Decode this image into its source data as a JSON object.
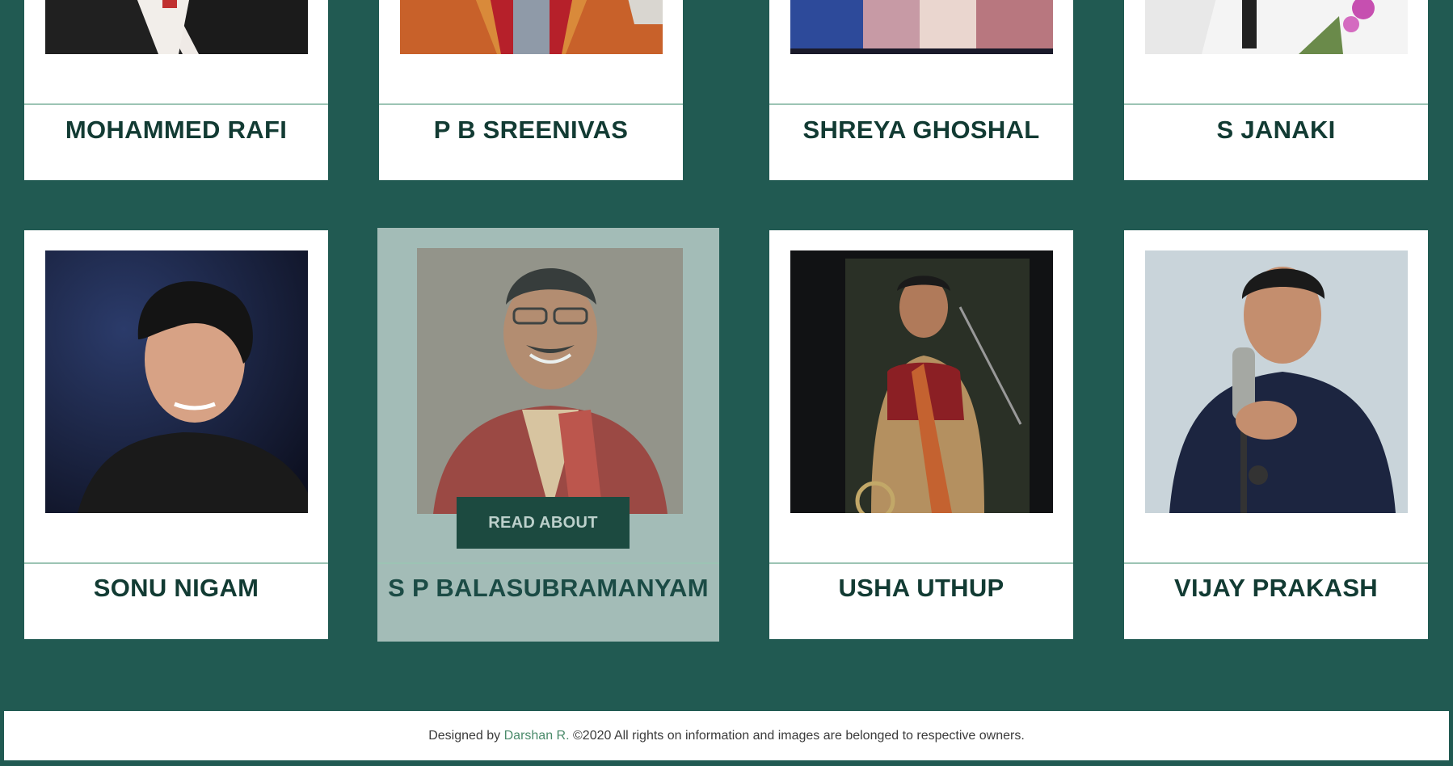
{
  "row1": [
    {
      "name": "MOHAMMED RAFI"
    },
    {
      "name": "P B SREENIVAS"
    },
    {
      "name": "SHREYA GHOSHAL"
    },
    {
      "name": "S JANAKI"
    }
  ],
  "row2": [
    {
      "name": "SONU NIGAM"
    },
    {
      "name": "S P BALASUBRAMANYAM",
      "button": "READ ABOUT"
    },
    {
      "name": "USHA UTHUP"
    },
    {
      "name": "VIJAY PRAKASH"
    }
  ],
  "footer": {
    "prefix": "Designed by",
    "author": "Darshan R.",
    "suffix": "©2020 All rights on information and images are belonged to respective owners."
  }
}
